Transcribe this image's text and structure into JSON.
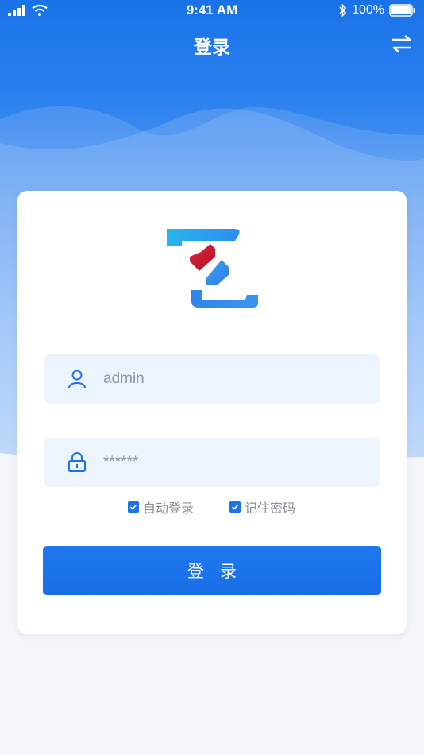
{
  "status_bar": {
    "time": "9:41 AM",
    "battery": "100%"
  },
  "header": {
    "title": "登录"
  },
  "form": {
    "username_value": "admin",
    "password_placeholder": "******",
    "auto_login_label": "自动登录",
    "remember_password_label": "记住密码",
    "submit_label": "登录"
  },
  "icons": {
    "switch": "swap-arrows-icon",
    "username": "user-icon",
    "password": "lock-icon",
    "checkbox": "checkmark-icon"
  },
  "colors": {
    "primary": "#1a73e8",
    "header_bg": "#1a72e8",
    "field_bg": "#eef4fd",
    "page_bg": "#f3f6fa"
  }
}
